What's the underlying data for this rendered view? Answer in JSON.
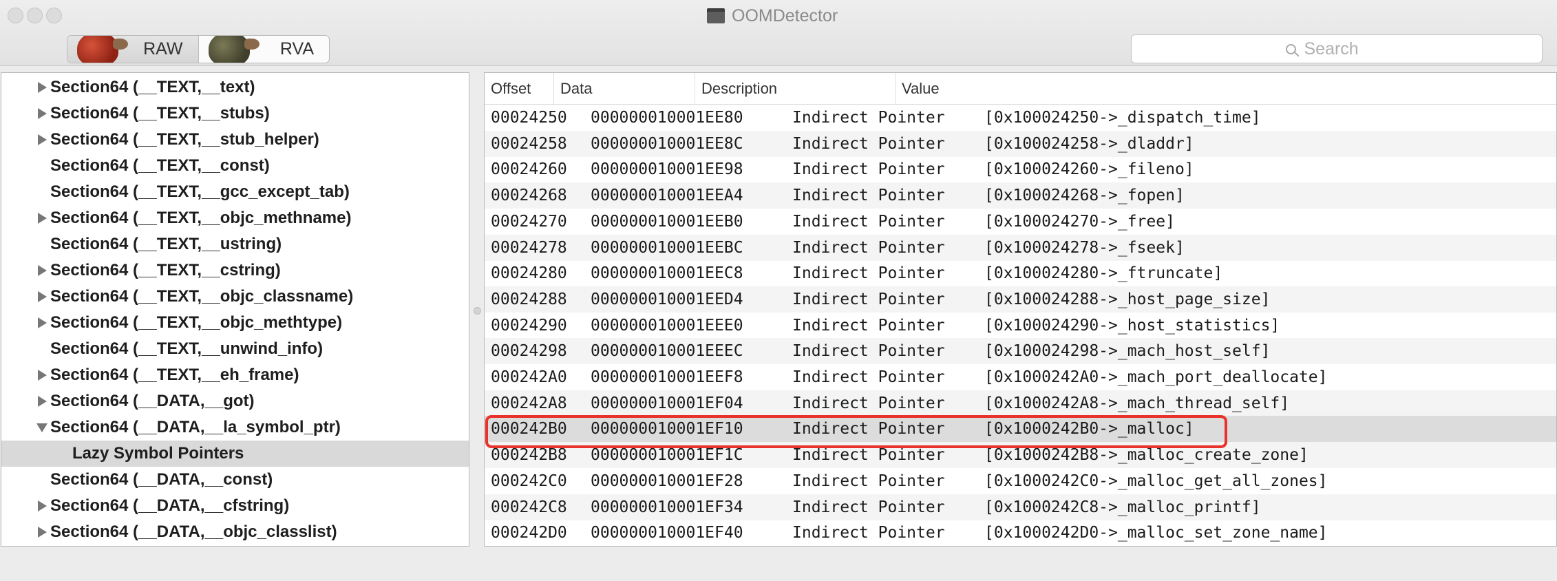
{
  "window": {
    "title": "OOMDetector"
  },
  "toolbar": {
    "segments": [
      {
        "label": "RAW"
      },
      {
        "label": "RVA"
      }
    ],
    "search": {
      "placeholder": "Search",
      "value": ""
    }
  },
  "sidebar": {
    "items": [
      {
        "label": "Section64 (__TEXT,__text)",
        "disclosure": "collapsed"
      },
      {
        "label": "Section64 (__TEXT,__stubs)",
        "disclosure": "collapsed"
      },
      {
        "label": "Section64 (__TEXT,__stub_helper)",
        "disclosure": "collapsed"
      },
      {
        "label": "Section64 (__TEXT,__const)",
        "disclosure": "none"
      },
      {
        "label": "Section64 (__TEXT,__gcc_except_tab)",
        "disclosure": "none"
      },
      {
        "label": "Section64 (__TEXT,__objc_methname)",
        "disclosure": "collapsed"
      },
      {
        "label": "Section64 (__TEXT,__ustring)",
        "disclosure": "none"
      },
      {
        "label": "Section64 (__TEXT,__cstring)",
        "disclosure": "collapsed"
      },
      {
        "label": "Section64 (__TEXT,__objc_classname)",
        "disclosure": "collapsed"
      },
      {
        "label": "Section64 (__TEXT,__objc_methtype)",
        "disclosure": "collapsed"
      },
      {
        "label": "Section64 (__TEXT,__unwind_info)",
        "disclosure": "none"
      },
      {
        "label": "Section64 (__TEXT,__eh_frame)",
        "disclosure": "collapsed"
      },
      {
        "label": "Section64 (__DATA,__got)",
        "disclosure": "collapsed"
      },
      {
        "label": "Section64 (__DATA,__la_symbol_ptr)",
        "disclosure": "expanded"
      },
      {
        "label": "Lazy Symbol Pointers",
        "disclosure": "none",
        "child": true,
        "selected": true
      },
      {
        "label": "Section64 (__DATA,__const)",
        "disclosure": "none"
      },
      {
        "label": "Section64 (__DATA,__cfstring)",
        "disclosure": "collapsed"
      },
      {
        "label": "Section64 (__DATA,__objc_classlist)",
        "disclosure": "collapsed"
      }
    ]
  },
  "table": {
    "columns": [
      "Offset",
      "Data",
      "Description",
      "Value"
    ],
    "rows": [
      [
        "00024250",
        "000000010001EE80",
        "Indirect Pointer",
        "[0x100024250->_dispatch_time]"
      ],
      [
        "00024258",
        "000000010001EE8C",
        "Indirect Pointer",
        "[0x100024258->_dladdr]"
      ],
      [
        "00024260",
        "000000010001EE98",
        "Indirect Pointer",
        "[0x100024260->_fileno]"
      ],
      [
        "00024268",
        "000000010001EEA4",
        "Indirect Pointer",
        "[0x100024268->_fopen]"
      ],
      [
        "00024270",
        "000000010001EEB0",
        "Indirect Pointer",
        "[0x100024270->_free]"
      ],
      [
        "00024278",
        "000000010001EEBC",
        "Indirect Pointer",
        "[0x100024278->_fseek]"
      ],
      [
        "00024280",
        "000000010001EEC8",
        "Indirect Pointer",
        "[0x100024280->_ftruncate]"
      ],
      [
        "00024288",
        "000000010001EED4",
        "Indirect Pointer",
        "[0x100024288->_host_page_size]"
      ],
      [
        "00024290",
        "000000010001EEE0",
        "Indirect Pointer",
        "[0x100024290->_host_statistics]"
      ],
      [
        "00024298",
        "000000010001EEEC",
        "Indirect Pointer",
        "[0x100024298->_mach_host_self]"
      ],
      [
        "000242A0",
        "000000010001EEF8",
        "Indirect Pointer",
        "[0x1000242A0->_mach_port_deallocate]"
      ],
      [
        "000242A8",
        "000000010001EF04",
        "Indirect Pointer",
        "[0x1000242A8->_mach_thread_self]"
      ],
      [
        "000242B0",
        "000000010001EF10",
        "Indirect Pointer",
        "[0x1000242B0->_malloc]"
      ],
      [
        "000242B8",
        "000000010001EF1C",
        "Indirect Pointer",
        "[0x1000242B8->_malloc_create_zone]"
      ],
      [
        "000242C0",
        "000000010001EF28",
        "Indirect Pointer",
        "[0x1000242C0->_malloc_get_all_zones]"
      ],
      [
        "000242C8",
        "000000010001EF34",
        "Indirect Pointer",
        "[0x1000242C8->_malloc_printf]"
      ],
      [
        "000242D0",
        "000000010001EF40",
        "Indirect Pointer",
        "[0x1000242D0->_malloc_set_zone_name]"
      ]
    ],
    "selected_row": 12,
    "highlighted_row": 12
  },
  "colors": {
    "highlight": "#e8322b",
    "selection": "#dcdcdc"
  }
}
